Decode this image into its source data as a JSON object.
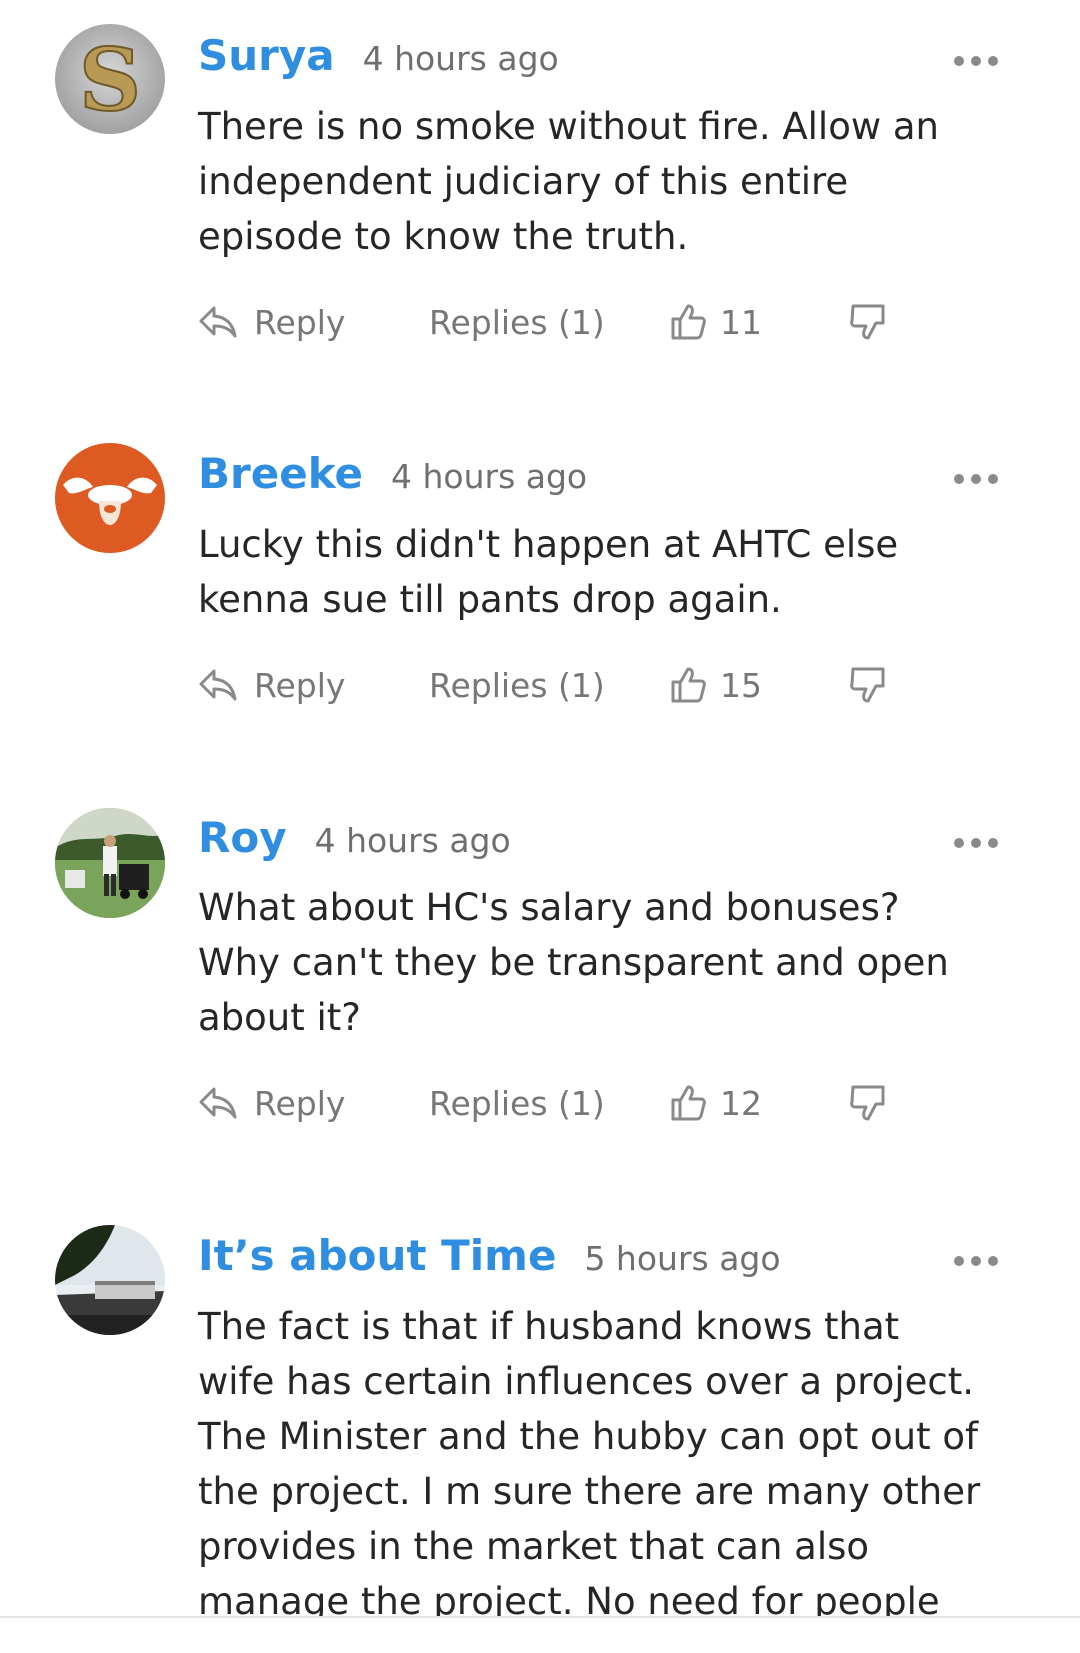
{
  "colors": {
    "author": "#2f8ee0",
    "meta": "#6f6f6f",
    "text": "#262626",
    "action": "#777777"
  },
  "comments": [
    {
      "author": "Surya",
      "time": "4 hours ago",
      "text": "There is no smoke without fire. Allow an independent judiciary of this entire episode to know the truth.",
      "reply_label": "Reply",
      "replies_label": "Replies (1)",
      "likes": "11",
      "avatar_icon": "letter-s-avatar"
    },
    {
      "author": "Breeke",
      "time": "4 hours ago",
      "text": "Lucky this didn't happen at AHTC else kenna sue till pants drop again.",
      "reply_label": "Reply",
      "replies_label": "Replies (1)",
      "likes": "15",
      "avatar_icon": "orange-cartoon-avatar"
    },
    {
      "author": "Roy",
      "time": "4 hours ago",
      "text": "What about HC's salary and bonuses? Why can't they be transparent and open about it?",
      "reply_label": "Reply",
      "replies_label": "Replies (1)",
      "likes": "12",
      "avatar_icon": "golf-photo-avatar"
    },
    {
      "author": "It’s about Time",
      "time": "5 hours ago",
      "text": "The fact is that if husband knows that wife has certain influences over a project. The Minister and the hubby can opt out of the project. I m sure there are many other provides in the market that can also manage the project. No need for people to",
      "avatar_icon": "landscape-photo-avatar"
    }
  ]
}
